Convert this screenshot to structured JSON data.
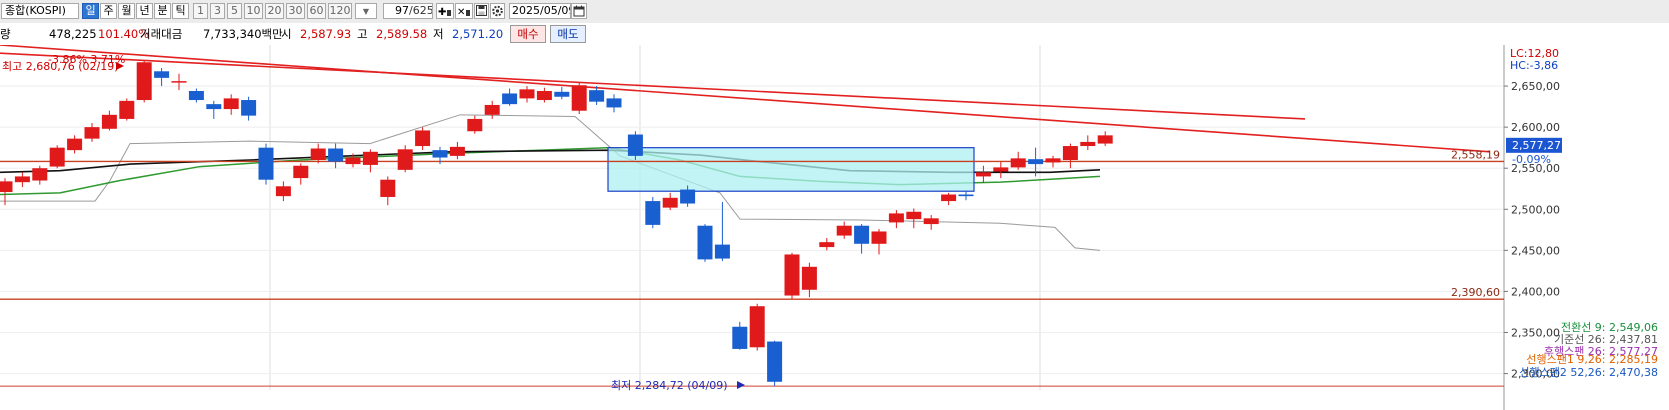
{
  "toolbar": {
    "market": "종합(KOSPI)",
    "periods": [
      "일",
      "주",
      "월",
      "년",
      "분",
      "틱"
    ],
    "active_period": "일",
    "intervals": [
      "1",
      "3",
      "5",
      "10",
      "20",
      "30",
      "60",
      "120"
    ],
    "count": "97",
    "total": "/625",
    "date": "2025/05/09"
  },
  "info": {
    "partial_label": "량",
    "volume": "478,225",
    "ratio": "101.40%",
    "amount_label": "거래대금",
    "amount": "7,733,340백만",
    "open_label": "시",
    "open": "2,587.93",
    "high_label": "고",
    "high": "2,589.58",
    "low_label": "저",
    "low": "2,571.20",
    "buy": "매수",
    "sell": "매도"
  },
  "chart_data": {
    "type": "candlestick",
    "y_axis": {
      "ticks": [
        "2,650,00",
        "2,600,00",
        "2,550,00",
        "2,500,00",
        "2,450,00",
        "2,400,00",
        "2,350,00",
        "2,300,00"
      ],
      "range": [
        2280,
        2700
      ],
      "top_labels": [
        {
          "text": "LC:12,80",
          "color": "#d10000"
        },
        {
          "text": "HC:-3,86",
          "color": "#1040c0"
        }
      ],
      "current_price": "2,577,27",
      "current_change": "-0.09%",
      "current_value": 2577.27,
      "level_labels": [
        {
          "text": "2,558,19",
          "value": 2558.19
        },
        {
          "text": "2,390,60",
          "value": 2390.6
        }
      ]
    },
    "annotations": {
      "high": {
        "text": "최고 2,680,76 (02/19)",
        "value": 2680.76
      },
      "high_pct": {
        "text": "-3.86% 3.71%"
      },
      "low": {
        "text": "최저 2,284,72 (04/09)",
        "value": 2284.72
      }
    },
    "legend": [
      {
        "text": "전환선 9: 2,549,06",
        "color": "#1a8f3c"
      },
      {
        "text": "기준선 26: 2,437,81",
        "color": "#555555"
      },
      {
        "text": "후행스팬 26: 2,577,27",
        "color": "#9b2fae"
      },
      {
        "text": "선행스팬1 9,26: 2,285,19",
        "color": "#e06000"
      },
      {
        "text": "선행스팬2 52,26: 2,470,38",
        "color": "#1a57c0"
      }
    ],
    "candles": [
      [
        2521,
        2534,
        2505,
        2538
      ],
      [
        2533,
        2540,
        2527,
        2545
      ],
      [
        2535,
        2550,
        2530,
        2553
      ],
      [
        2552,
        2575,
        2550,
        2578
      ],
      [
        2572,
        2586,
        2568,
        2590
      ],
      [
        2586,
        2600,
        2582,
        2605
      ],
      [
        2598,
        2615,
        2596,
        2620
      ],
      [
        2610,
        2632,
        2608,
        2635
      ],
      [
        2633,
        2679,
        2630,
        2681
      ],
      [
        2668,
        2660,
        2650,
        2672
      ],
      [
        2655,
        2656,
        2645,
        2665
      ],
      [
        2644,
        2633,
        2630,
        2647
      ],
      [
        2628,
        2622,
        2610,
        2632
      ],
      [
        2622,
        2635,
        2615,
        2640
      ],
      [
        2633,
        2614,
        2608,
        2637
      ],
      [
        2575,
        2536,
        2530,
        2580
      ],
      [
        2516,
        2528,
        2510,
        2534
      ],
      [
        2538,
        2553,
        2530,
        2556
      ],
      [
        2560,
        2574,
        2556,
        2580
      ],
      [
        2574,
        2558,
        2550,
        2580
      ],
      [
        2555,
        2563,
        2551,
        2568
      ],
      [
        2554,
        2570,
        2545,
        2573
      ],
      [
        2515,
        2536,
        2505,
        2540
      ],
      [
        2548,
        2573,
        2545,
        2578
      ],
      [
        2577,
        2596,
        2572,
        2600
      ],
      [
        2572,
        2563,
        2555,
        2576
      ],
      [
        2565,
        2576,
        2561,
        2582
      ],
      [
        2595,
        2610,
        2592,
        2614
      ],
      [
        2615,
        2627,
        2610,
        2632
      ],
      [
        2641,
        2628,
        2626,
        2647
      ],
      [
        2635,
        2646,
        2630,
        2650
      ],
      [
        2633,
        2644,
        2630,
        2648
      ],
      [
        2643,
        2637,
        2634,
        2649
      ],
      [
        2620,
        2651,
        2616,
        2655
      ],
      [
        2645,
        2631,
        2627,
        2650
      ],
      [
        2635,
        2624,
        2618,
        2640
      ],
      [
        2591,
        2565,
        2560,
        2595
      ],
      [
        2510,
        2481,
        2477,
        2515
      ],
      [
        2502,
        2514,
        2499,
        2520
      ],
      [
        2524,
        2507,
        2503,
        2529
      ],
      [
        2480,
        2439,
        2436,
        2482
      ],
      [
        2457,
        2440,
        2437,
        2509
      ],
      [
        2357,
        2330,
        2329,
        2363
      ],
      [
        2332,
        2382,
        2328,
        2385
      ],
      [
        2339,
        2290,
        2285,
        2340
      ],
      [
        2395,
        2445,
        2391,
        2447
      ],
      [
        2402,
        2430,
        2393,
        2435
      ],
      [
        2454,
        2460,
        2450,
        2465
      ],
      [
        2468,
        2480,
        2464,
        2485
      ],
      [
        2480,
        2458,
        2446,
        2482
      ],
      [
        2458,
        2473,
        2445,
        2476
      ],
      [
        2484,
        2495,
        2477,
        2499
      ],
      [
        2488,
        2497,
        2477,
        2501
      ],
      [
        2482,
        2489,
        2475,
        2493
      ],
      [
        2510,
        2518,
        2505,
        2520
      ],
      [
        2518,
        2516,
        2511,
        2522
      ],
      [
        2540,
        2545,
        2532,
        2553
      ],
      [
        2546,
        2551,
        2538,
        2558
      ],
      [
        2551,
        2562,
        2548,
        2570
      ],
      [
        2561,
        2555,
        2540,
        2575
      ],
      [
        2557,
        2562,
        2551,
        2565
      ],
      [
        2560,
        2577,
        2550,
        2580
      ],
      [
        2577,
        2582,
        2572,
        2590
      ],
      [
        2580,
        2590,
        2577,
        2595
      ]
    ]
  }
}
